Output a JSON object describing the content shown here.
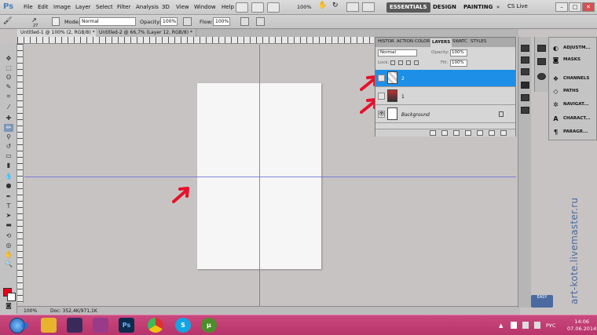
{
  "menubar": {
    "logo": "Ps",
    "items": [
      "File",
      "Edit",
      "Image",
      "Layer",
      "Select",
      "Filter",
      "Analysis",
      "3D",
      "View",
      "Window",
      "Help"
    ],
    "zoom": "100%",
    "workspaces": [
      "ESSENTIALS",
      "DESIGN",
      "PAINTING"
    ],
    "more": "»",
    "cslive": "CS Live"
  },
  "options": {
    "brush_size": "27",
    "mode_label": "Mode:",
    "mode_value": "Normal",
    "opacity_label": "Opacity:",
    "opacity_value": "100%",
    "flow_label": "Flow:",
    "flow_value": "100%"
  },
  "tabs": [
    {
      "label": "Untitled-1 @ 100% (2, RGB/8) *"
    },
    {
      "label": "Untitled-2 @ 66,7% (Layer 12, RGB/8) *"
    }
  ],
  "status": {
    "zoom": "100%",
    "doc": "Doc: 352,4K/971,1K"
  },
  "layers_panel": {
    "tabs": [
      "HISTOR",
      "ACTION",
      "COLOR",
      "LAYERS",
      "SWATC",
      "STYLES"
    ],
    "blend_mode": "Normal",
    "opacity_label": "Opacity:",
    "opacity_value": "100%",
    "lock_label": "Lock:",
    "fill_label": "Fill:",
    "fill_value": "100%",
    "layers": [
      {
        "name": "2",
        "selected": true
      },
      {
        "name": "1",
        "selected": false
      },
      {
        "name": "Background",
        "selected": false
      }
    ]
  },
  "dock": {
    "items": [
      "ADJUSTM...",
      "MASKS",
      "CHANNELS",
      "PATHS",
      "NAVIGAT...",
      "CHARACT...",
      "PARAGR..."
    ]
  },
  "watermark": "art-kote.livemaster.ru",
  "easy_logo": "EASY",
  "taskbar": {
    "lang": "РУС",
    "time": "14:06",
    "date": "07.06.2014"
  },
  "colors": {
    "foreground": "#e8001a",
    "background": "#ffffff",
    "selection": "#1e8fe6",
    "guide": "#6f6fd8",
    "arrow": "#e8102a",
    "taskbar": "#c0407a"
  }
}
